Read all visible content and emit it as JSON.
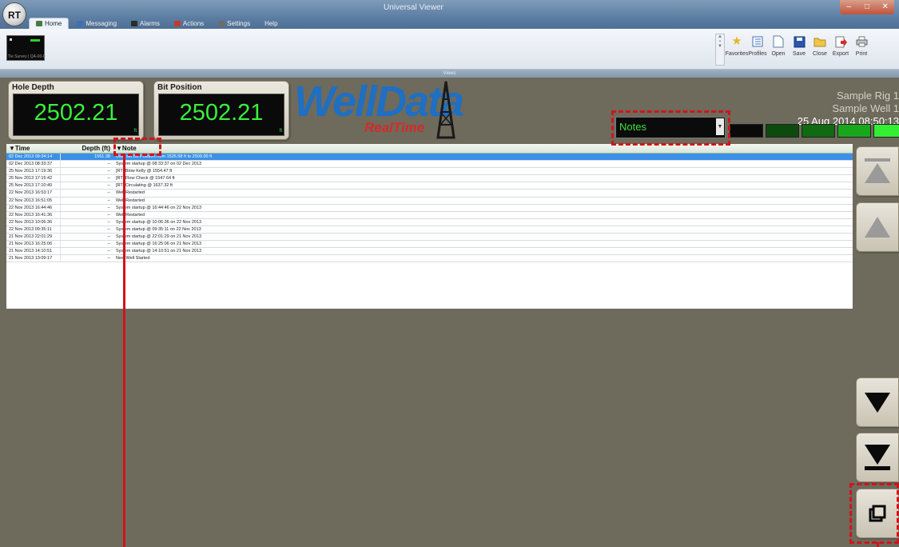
{
  "window": {
    "title": "Universal Viewer"
  },
  "tabs": [
    {
      "label": "Home",
      "active": true,
      "icon": "home-icon",
      "color": "#4a7a3d"
    },
    {
      "label": "Messaging",
      "active": false,
      "icon": "messaging-icon",
      "color": "#3f6fb4"
    },
    {
      "label": "Alarms",
      "active": false,
      "icon": "alarms-icon",
      "color": "#2b2b2b"
    },
    {
      "label": "Actions",
      "active": false,
      "icon": "actions-icon",
      "color": "#c23b2a"
    },
    {
      "label": "Settings",
      "active": false,
      "icon": "settings-icon",
      "color": "#6c6c6c"
    },
    {
      "label": "Help",
      "active": false,
      "icon": "",
      "color": ""
    }
  ],
  "ribbon": {
    "survey_label": "Tie Survey | QA-00-0",
    "tools": [
      {
        "label": "Favorites",
        "icon": "star-icon"
      },
      {
        "label": "Profiles",
        "icon": "profiles-icon"
      },
      {
        "label": "Open",
        "icon": "open-icon"
      },
      {
        "label": "Save",
        "icon": "save-icon"
      },
      {
        "label": "Close",
        "icon": "close-folder-icon"
      },
      {
        "label": "Export",
        "icon": "export-icon"
      },
      {
        "label": "Print",
        "icon": "print-icon"
      }
    ],
    "group_label": "Views"
  },
  "gauges": {
    "hole_depth": {
      "title": "Hole Depth",
      "value": "2502.21",
      "unit": "ft"
    },
    "bit_position": {
      "title": "Bit Position",
      "value": "2502.21",
      "unit": "ft"
    }
  },
  "logo": {
    "main": "WellData",
    "sub": "RealTime"
  },
  "rig": {
    "rig_name": "Sample Rig 1",
    "well_name": "Sample Well 1",
    "datetime": "25 Aug 2014 08:50:13"
  },
  "view_select": {
    "value": "Notes"
  },
  "leds": [
    "#0a0a0a",
    "#0d4a0d",
    "#0f6a12",
    "#19a81c",
    "#33ee33",
    "#2ed52e"
  ],
  "table": {
    "headers": {
      "time": "▼Time",
      "depth": "Depth (ft)",
      "note": "▼Note"
    },
    "rows": [
      {
        "time": "02 Dec 2013 09:34:14",
        "depth": "1561.38",
        "note": "User set Bit Position from 1526.58 ft to 2500.00 ft",
        "selected": true
      },
      {
        "time": "02 Dec 2013 08:33:37",
        "depth": "--",
        "note": "System startup @ 08:33:37 on 02 Dec 2013",
        "selected": false
      },
      {
        "time": "25 Nov 2013 17:19:36",
        "depth": "--",
        "note": "[RT] Blow Kelly @ 1554.47 ft",
        "selected": false
      },
      {
        "time": "25 Nov 2013 17:15:42",
        "depth": "--",
        "note": "[RT] Flow Check @ 1547.64 ft",
        "selected": false
      },
      {
        "time": "25 Nov 2013 17:10:40",
        "depth": "--",
        "note": "[RT] Circulating @ 1637.32 ft",
        "selected": false
      },
      {
        "time": "22 Nov 2013 16:53:17",
        "depth": "--",
        "note": "Well Restarted",
        "selected": false
      },
      {
        "time": "22 Nov 2013 16:51:05",
        "depth": "--",
        "note": "Well Restarted",
        "selected": false
      },
      {
        "time": "22 Nov 2013 16:44:46",
        "depth": "--",
        "note": "System startup @ 16:44:46 on 22 Nov 2013",
        "selected": false
      },
      {
        "time": "22 Nov 2013 16:41:36",
        "depth": "--",
        "note": "Well Restarted",
        "selected": false
      },
      {
        "time": "22 Nov 2013 10:06:36",
        "depth": "--",
        "note": "System startup @ 10:06:36 on 22 Nov 2013",
        "selected": false
      },
      {
        "time": "22 Nov 2013 09:35:11",
        "depth": "--",
        "note": "System startup @ 09:35:11 on 22 Nov 2013",
        "selected": false
      },
      {
        "time": "21 Nov 2013 22:01:29",
        "depth": "--",
        "note": "System startup @ 22:01:29 on 21 Nov 2013",
        "selected": false
      },
      {
        "time": "21 Nov 2013 16:25:06",
        "depth": "--",
        "note": "System startup @ 16:25:06 on 21 Nov 2013",
        "selected": false
      },
      {
        "time": "21 Nov 2013 14:10:51",
        "depth": "--",
        "note": "System startup @ 14:10:51 on 21 Nov 2013",
        "selected": false
      },
      {
        "time": "21 Nov 2013 13:09:17",
        "depth": "--",
        "note": "New Well Started",
        "selected": false
      }
    ]
  },
  "nav_buttons": [
    {
      "name": "scroll-top-button",
      "icon": "scroll-top-icon"
    },
    {
      "name": "scroll-up-button",
      "icon": "scroll-up-icon"
    },
    {
      "name": "scroll-down-button",
      "icon": "scroll-down-icon"
    },
    {
      "name": "scroll-bottom-button",
      "icon": "scroll-bottom-icon"
    },
    {
      "name": "window-toggle-button",
      "icon": "window-icon"
    }
  ],
  "colors": {
    "background": "#6e6a5c",
    "gauge_text": "#3bf03b",
    "selection": "#3b90e8",
    "annotation": "#d0141c"
  }
}
